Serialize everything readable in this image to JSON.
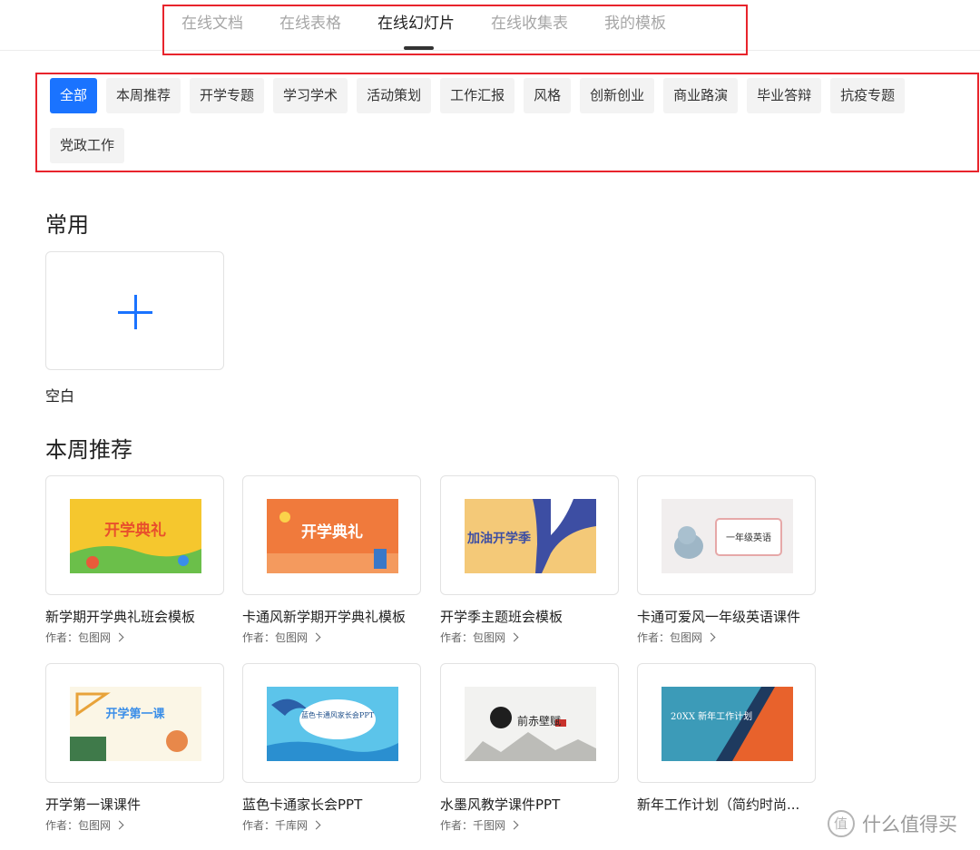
{
  "tabs": [
    {
      "label": "在线文档",
      "active": false
    },
    {
      "label": "在线表格",
      "active": false
    },
    {
      "label": "在线幻灯片",
      "active": true
    },
    {
      "label": "在线收集表",
      "active": false
    },
    {
      "label": "我的模板",
      "active": false
    }
  ],
  "categories": [
    {
      "label": "全部",
      "active": true
    },
    {
      "label": "本周推荐"
    },
    {
      "label": "开学专题"
    },
    {
      "label": "学习学术"
    },
    {
      "label": "活动策划"
    },
    {
      "label": "工作汇报"
    },
    {
      "label": "风格"
    },
    {
      "label": "创新创业"
    },
    {
      "label": "商业路演"
    },
    {
      "label": "毕业答辩"
    },
    {
      "label": "抗疫专题"
    },
    {
      "label": "党政工作"
    }
  ],
  "common": {
    "title": "常用",
    "blank_label": "空白"
  },
  "weekly": {
    "title": "本周推荐",
    "items": [
      {
        "title": "新学期开学典礼班会模板",
        "author": "作者：包图网",
        "thumb_text": "开学典礼"
      },
      {
        "title": "卡通风新学期开学典礼模板",
        "author": "作者：包图网",
        "thumb_text": "开学典礼"
      },
      {
        "title": "开学季主题班会模板",
        "author": "作者：包图网",
        "thumb_text": "加油开学季"
      },
      {
        "title": "卡通可爱风一年级英语课件",
        "author": "作者：包图网",
        "thumb_text": "一年级英语"
      },
      {
        "title": "开学第一课课件",
        "author": "作者：包图网",
        "thumb_text": "开学第一课"
      },
      {
        "title": "蓝色卡通家长会PPT",
        "author": "作者：千库网",
        "thumb_text": "蓝色卡通风家长会PPT"
      },
      {
        "title": "水墨风教学课件PPT",
        "author": "作者：千图网",
        "thumb_text": "前赤壁赋"
      },
      {
        "title": "新年工作计划（简约时尚...",
        "author": "",
        "thumb_text": "20XX 新年工作计划"
      }
    ]
  },
  "watermark": "什么值得买",
  "colors": {
    "accent": "#1a73ff",
    "highlight_border": "#e8242c"
  }
}
